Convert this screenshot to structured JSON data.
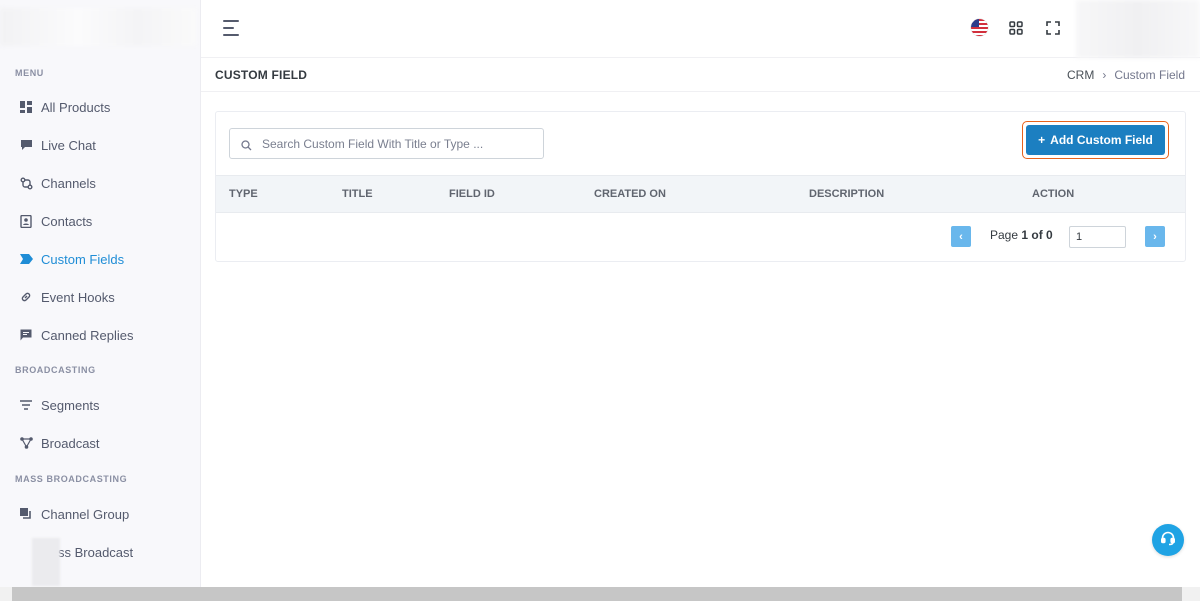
{
  "sidebar": {
    "sections": [
      {
        "title": "MENU"
      },
      {
        "title": "BROADCASTING"
      },
      {
        "title": "MASS BROADCASTING"
      }
    ],
    "items": [
      {
        "label": "All Products",
        "icon": "grid-icon"
      },
      {
        "label": "Live Chat",
        "icon": "chat-icon"
      },
      {
        "label": "Channels",
        "icon": "channels-icon"
      },
      {
        "label": "Contacts",
        "icon": "contacts-icon"
      },
      {
        "label": "Custom Fields",
        "icon": "tag-icon",
        "active": true
      },
      {
        "label": "Event Hooks",
        "icon": "link-icon"
      },
      {
        "label": "Canned Replies",
        "icon": "message-icon"
      },
      {
        "label": "Segments",
        "icon": "filter-icon"
      },
      {
        "label": "Broadcast",
        "icon": "broadcast-icon"
      },
      {
        "label": "Channel Group",
        "icon": "channel-group-icon"
      },
      {
        "label": "ss Broadcast",
        "icon": "mass-broadcast-icon"
      }
    ]
  },
  "header": {
    "language": "English (US)"
  },
  "page": {
    "title": "CUSTOM FIELD",
    "breadcrumb": [
      "CRM",
      "Custom Field"
    ]
  },
  "toolbar": {
    "search_placeholder": "Search Custom Field With Title or Type ...",
    "add_button_label": "Add Custom Field"
  },
  "table": {
    "columns": [
      "TYPE",
      "TITLE",
      "FIELD ID",
      "CREATED ON",
      "DESCRIPTION",
      "ACTION"
    ],
    "rows": []
  },
  "pagination": {
    "prefix": "Page",
    "current": "1 of 0",
    "input_value": "1",
    "prev_label": "‹",
    "next_label": "›"
  },
  "colors": {
    "accent": "#1c7fc1",
    "active_nav": "#1f8dd6",
    "highlight_border": "#e8621c"
  }
}
